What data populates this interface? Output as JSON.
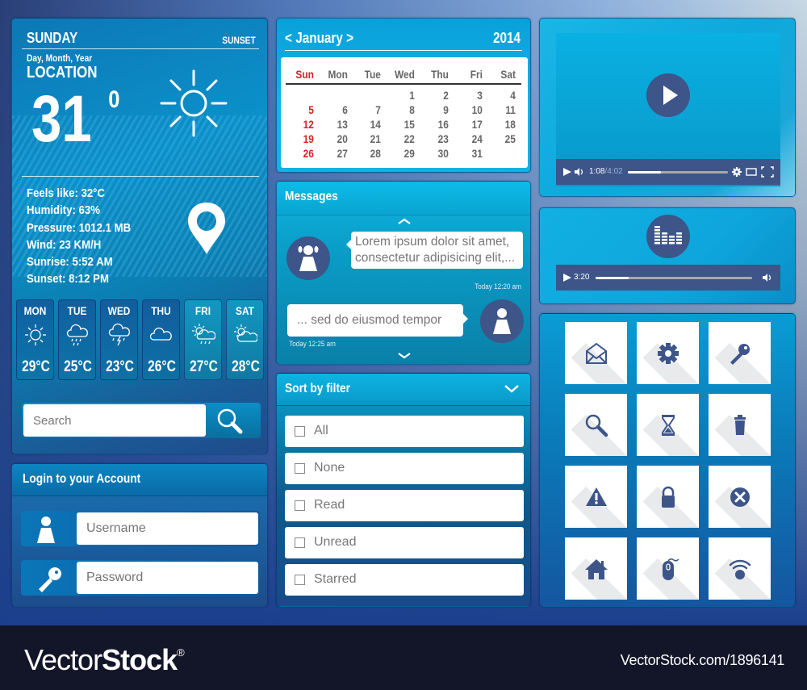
{
  "weather": {
    "day": "SUNDAY",
    "sunset_label": "SUNSET",
    "date": "Day, Month, Year",
    "location": "LOCATION",
    "temperature": "31",
    "degree": "0",
    "condition_icon": "sun-icon",
    "details": [
      "Feels like: 32°C",
      "Humidity: 63%",
      "Pressure: 1012.1 MB",
      "Wind: 23 KM/H",
      "Sunrise: 5:52 AM",
      "Sunset: 8:12 PM"
    ],
    "forecast": [
      {
        "day": "MON",
        "temp": "29",
        "unit": "°C",
        "icon": "sunny-icon"
      },
      {
        "day": "TUE",
        "temp": "25",
        "unit": "°C",
        "icon": "rain-icon"
      },
      {
        "day": "WED",
        "temp": "23",
        "unit": "°C",
        "icon": "thunderstorm-icon"
      },
      {
        "day": "THU",
        "temp": "26",
        "unit": "°C",
        "icon": "cloudy-icon"
      },
      {
        "day": "FRI",
        "temp": "27",
        "unit": "°C",
        "icon": "sun-rain-icon"
      },
      {
        "day": "SAT",
        "temp": "28",
        "unit": "°C",
        "icon": "partly-cloudy-icon"
      }
    ]
  },
  "search": {
    "placeholder": "Search"
  },
  "login": {
    "title": "Login to your Account",
    "username_placeholder": "Username",
    "password_placeholder": "Password"
  },
  "calendar": {
    "month": "January",
    "year": "2014",
    "prev": "<",
    "next": ">",
    "weekdays": [
      "Sun",
      "Mon",
      "Tue",
      "Wed",
      "Thu",
      "Fri",
      "Sat"
    ],
    "weeks": [
      [
        "",
        "",
        "",
        "1",
        "2",
        "3",
        "4"
      ],
      [
        "5",
        "6",
        "7",
        "8",
        "9",
        "10",
        "11"
      ],
      [
        "12",
        "13",
        "14",
        "15",
        "16",
        "17",
        "18"
      ],
      [
        "19",
        "20",
        "21",
        "22",
        "23",
        "24",
        "25"
      ],
      [
        "26",
        "27",
        "28",
        "29",
        "30",
        "31",
        ""
      ]
    ],
    "accent": "#d82025"
  },
  "messages": {
    "title": "Messages",
    "items": [
      {
        "text": "Lorem ipsum dolor sit amet, consectetur adipisicing elit,...",
        "time": "Today 12:20 am",
        "side": "left"
      },
      {
        "text": "... sed do eiusmod tempor",
        "time": "Today 12:25 am",
        "side": "right"
      }
    ]
  },
  "filter": {
    "title": "Sort by filter",
    "options": [
      "All",
      "None",
      "Read",
      "Unread",
      "Starred"
    ]
  },
  "video": {
    "current": "1:08",
    "duration": "/4:02",
    "progress": 0.33
  },
  "audio": {
    "time": "3:20",
    "progress": 0.21
  },
  "icon_grid": [
    "envelope-open-icon",
    "gear-icon",
    "key-icon",
    "search-icon",
    "hourglass-icon",
    "trash-icon",
    "warning-icon",
    "lock-icon",
    "close-circle-icon",
    "home-icon",
    "mouse-icon",
    "wifi-icon"
  ],
  "footer": {
    "logo_light": "Vector",
    "logo_bold": "Stock",
    "logo_reg": "®",
    "url": "VectorStock.com/1896141"
  },
  "colors": {
    "icon_dark": "#3d5589",
    "sunday_red": "#d82025"
  }
}
